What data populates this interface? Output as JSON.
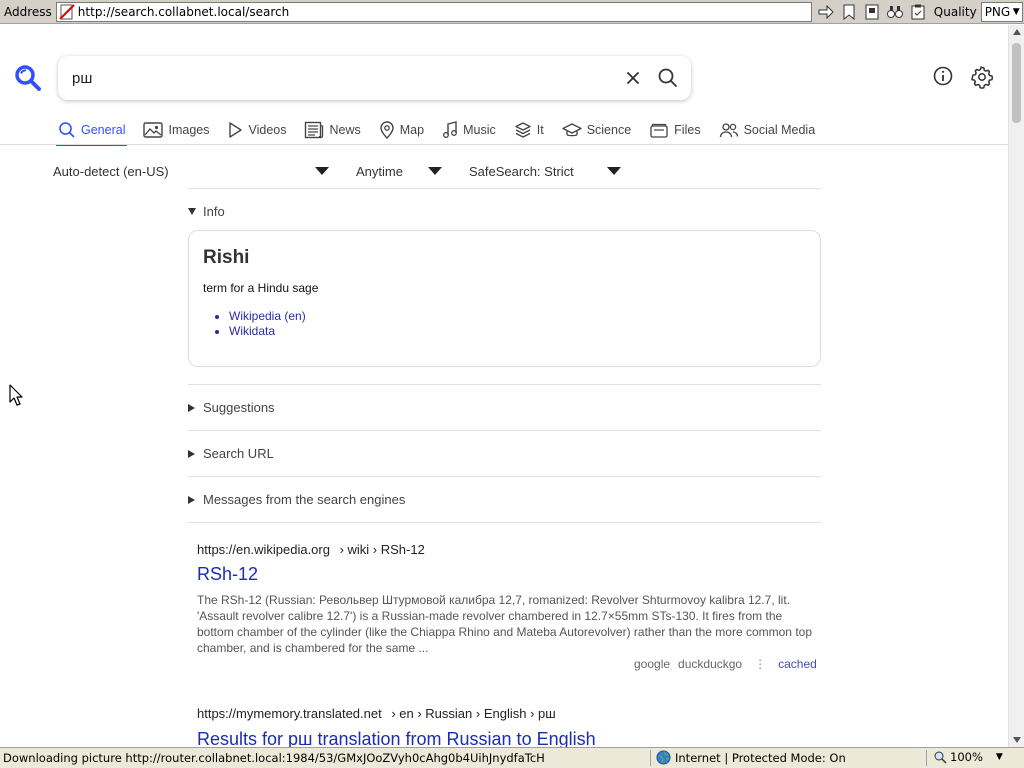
{
  "browser": {
    "address_label": "Address",
    "url": "http://search.collabnet.local/search",
    "quality_label": "Quality",
    "quality_value": "PNG"
  },
  "search": {
    "query": "рш"
  },
  "categories": [
    {
      "label": "General",
      "icon": "magnifier-icon",
      "active": true
    },
    {
      "label": "Images",
      "icon": "image-icon"
    },
    {
      "label": "Videos",
      "icon": "play-icon"
    },
    {
      "label": "News",
      "icon": "newspaper-icon"
    },
    {
      "label": "Map",
      "icon": "map-pin-icon"
    },
    {
      "label": "Music",
      "icon": "music-note-icon"
    },
    {
      "label": "It",
      "icon": "layers-icon"
    },
    {
      "label": "Science",
      "icon": "graduation-cap-icon"
    },
    {
      "label": "Files",
      "icon": "files-icon"
    },
    {
      "label": "Social Media",
      "icon": "people-icon"
    }
  ],
  "filters": {
    "language": "Auto-detect (en-US)",
    "time": "Anytime",
    "safesearch": "SafeSearch: Strict"
  },
  "info": {
    "header": "Info",
    "title": "Rishi",
    "description": "term for a Hindu sage",
    "links": [
      "Wikipedia (en)",
      "Wikidata"
    ]
  },
  "sections": {
    "suggestions": "Suggestions",
    "search_url": "Search URL",
    "messages": "Messages from the search engines"
  },
  "results": [
    {
      "url_host": "https://en.wikipedia.org",
      "url_path": "› wiki › RSh-12",
      "title": "RSh-12",
      "snippet": "The RSh-12 (Russian: Револьвер Штурмовой калибра 12,7, romanized: Revolver Shturmovoy kalibra 12.7, lit. 'Assault revolver calibre 12.7') is a Russian-made revolver chambered in 12.7×55mm STs-130. It fires from the bottom chamber of the cylinder (like the Chiappa Rhino and Mateba Autorevolver) rather than the more common top chamber, and is chambered for the same ...",
      "engines": [
        "google",
        "duckduckgo"
      ],
      "cached": "cached"
    },
    {
      "url_host": "https://mymemory.translated.net",
      "url_path": "› en › Russian › English › рш",
      "title": "Results for рш translation from Russian to English"
    }
  ],
  "status": {
    "text": "Downloading picture http://router.collabnet.local:1984/53/GMxJOoZVyh0cAhg0b4UihJnydfaTcH",
    "zone": "Internet | Protected Mode: On",
    "zoom": "100%"
  },
  "colors": {
    "accent": "#3050ff",
    "link": "#1a2db4"
  }
}
